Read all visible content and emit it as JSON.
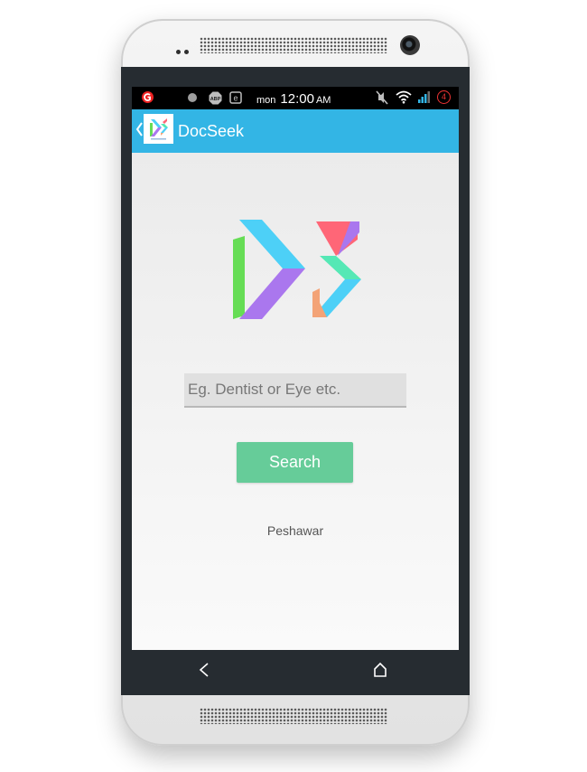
{
  "statusbar": {
    "day": "mon",
    "time": "12:00",
    "ampm": "AM",
    "notification_count": "4",
    "left_icons": [
      "app-notification-icon",
      "record-icon",
      "abp-icon",
      "e-icon"
    ],
    "right_icons": [
      "mute-icon",
      "wifi-icon",
      "signal-icon",
      "battery-count-icon"
    ]
  },
  "actionbar": {
    "title": "DocSeek",
    "background": "#33b5e5"
  },
  "search": {
    "placeholder": "Eg. Dentist or Eye etc.",
    "value": ""
  },
  "search_button": {
    "label": "Search",
    "color": "#66cc99"
  },
  "location": "Peshawar",
  "navbar": {
    "icons": [
      "back-icon",
      "home-icon"
    ]
  },
  "logo_colors": [
    "#4dd0f7",
    "#66dd55",
    "#aa77ee",
    "#ff6677",
    "#55e8b5",
    "#f3a377"
  ]
}
